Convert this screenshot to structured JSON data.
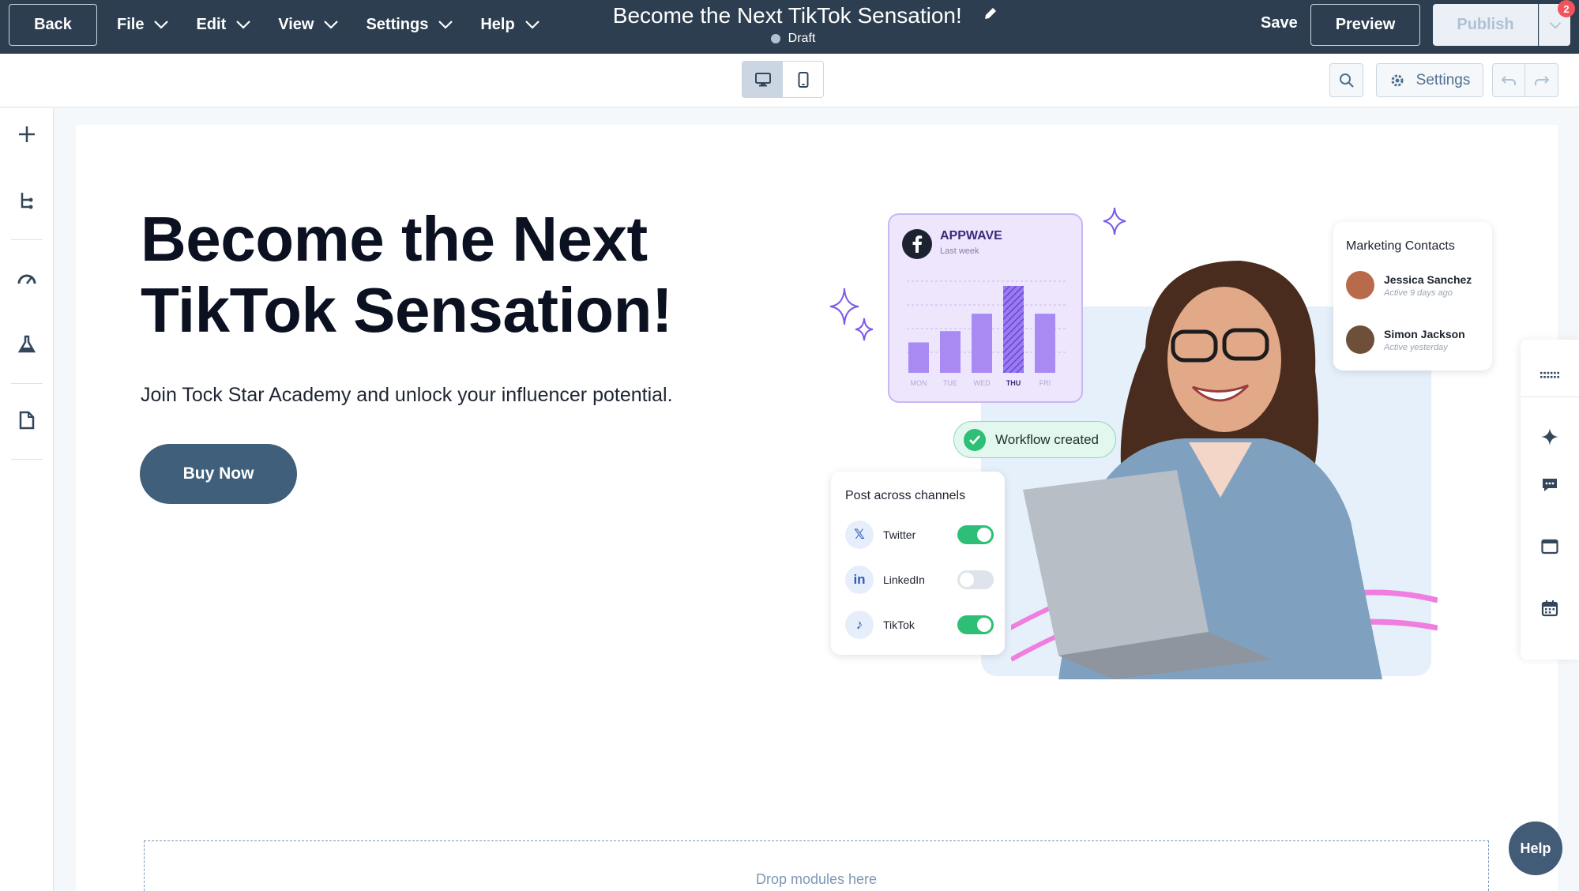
{
  "topbar": {
    "back_label": "Back",
    "menu": [
      {
        "label": "File"
      },
      {
        "label": "Edit"
      },
      {
        "label": "View"
      },
      {
        "label": "Settings"
      },
      {
        "label": "Help"
      }
    ],
    "page_title": "Become the Next TikTok Sensation!",
    "status": "Draft",
    "save_label": "Save",
    "preview_label": "Preview",
    "publish_label": "Publish",
    "notification_count": "2"
  },
  "toolbar": {
    "device_options": [
      "desktop-icon",
      "mobile-icon"
    ],
    "active_device": "desktop",
    "settings_label": "Settings"
  },
  "left_rail": {
    "icons": [
      "plus-icon",
      "tree-icon",
      "gauge-icon",
      "flask-icon",
      "document-icon"
    ]
  },
  "hero": {
    "title": "Become the Next TikTok Sensation!",
    "subtitle": "Join Tock Star Academy and unlock your influencer potential.",
    "cta_label": "Buy Now"
  },
  "illustration": {
    "appwave": {
      "title": "APPWAVE",
      "subtitle": "Last week",
      "days": [
        "MON",
        "TUE",
        "WED",
        "THU",
        "FRI"
      ],
      "values": [
        0.35,
        0.48,
        0.68,
        1.0,
        0.68
      ],
      "highlight_index": 3
    },
    "workflow_badge": "Workflow created",
    "post_card": {
      "title": "Post across channels",
      "channels": [
        {
          "name": "Twitter",
          "icon": "x-icon",
          "enabled": true
        },
        {
          "name": "LinkedIn",
          "icon": "linkedin-icon",
          "enabled": false
        },
        {
          "name": "TikTok",
          "icon": "tiktok-icon",
          "enabled": true
        }
      ]
    },
    "contacts_card": {
      "title": "Marketing Contacts",
      "contacts": [
        {
          "name": "Jessica Sanchez",
          "status": "Active 9 days ago"
        },
        {
          "name": "Simon Jackson",
          "status": "Active yesterday"
        }
      ]
    }
  },
  "right_rail": {
    "icons": [
      "grid-dots-icon",
      "sparkle-icon",
      "chat-icon",
      "browser-icon",
      "calendar-icon"
    ]
  },
  "dropzone_label": "Drop modules here",
  "help_label": "Help",
  "colors": {
    "topbar": "#2d3e50",
    "cta": "#3f5f7a",
    "accent_purple": "#9b7cf0",
    "success": "#2ebf77"
  }
}
